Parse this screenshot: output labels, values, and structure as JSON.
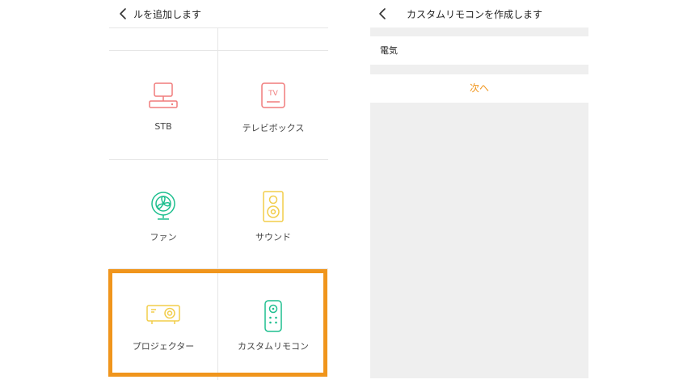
{
  "left_screen": {
    "header": {
      "title": "ルを追加します"
    },
    "devices": [
      {
        "label": "STB",
        "icon": "stb-icon",
        "color": "#f07c7c"
      },
      {
        "label": "テレビボックス",
        "icon": "tv-box-icon",
        "color": "#f07c7c"
      },
      {
        "label": "ファン",
        "icon": "fan-icon",
        "color": "#1fbf8f"
      },
      {
        "label": "サウンド",
        "icon": "speaker-icon",
        "color": "#f2cd4a"
      },
      {
        "label": "プロジェクター",
        "icon": "projector-icon",
        "color": "#f2cd4a"
      },
      {
        "label": "カスタムリモコン",
        "icon": "remote-control-icon",
        "color": "#1fbf8f"
      }
    ],
    "tv_icon_text": "TV",
    "highlight_color": "#f0951c"
  },
  "right_screen": {
    "header": {
      "title": "カスタムリモコンを作成します"
    },
    "name_field": {
      "value": "電気"
    },
    "next_button": {
      "label": "次へ",
      "color": "#f0951c"
    }
  }
}
